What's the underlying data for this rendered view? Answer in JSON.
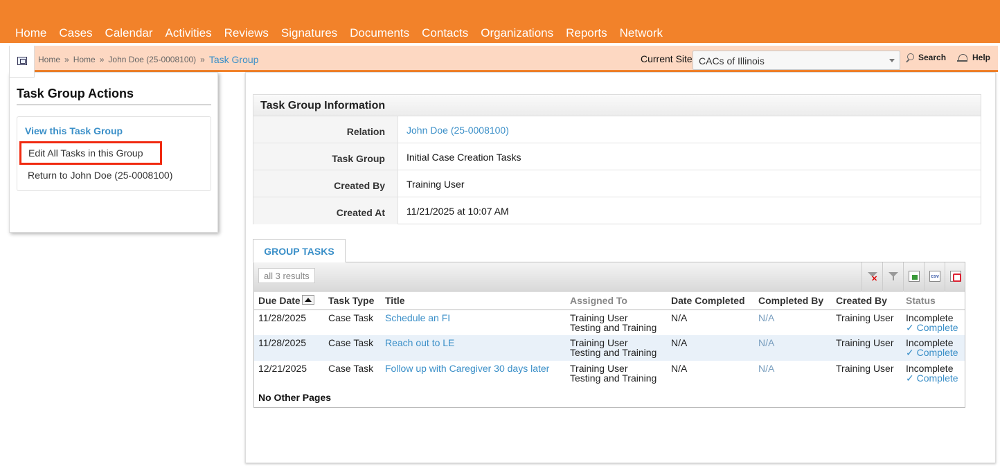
{
  "nav": {
    "items": [
      "Home",
      "Cases",
      "Calendar",
      "Activities",
      "Reviews",
      "Signatures",
      "Documents",
      "Contacts",
      "Organizations",
      "Reports",
      "Network"
    ]
  },
  "breadcrumb": {
    "items": [
      "Home",
      "Home",
      "John Doe (25-0008100)"
    ],
    "separator": "»",
    "current": "Task Group"
  },
  "site": {
    "label": "Current Site",
    "selected": "CACs of Illinois"
  },
  "toolbar": {
    "search_label": "Search",
    "help_label": "Help"
  },
  "sidebar": {
    "title": "Task Group Actions",
    "actions": {
      "view": "View this Task Group",
      "edit": "Edit All Tasks in this Group",
      "return": "Return to John Doe (25-0008100)"
    }
  },
  "info": {
    "title": "Task Group Information",
    "rows": [
      {
        "label": "Relation",
        "value": "John Doe (25-0008100)"
      },
      {
        "label": "Task Group",
        "value": "Initial Case Creation Tasks"
      },
      {
        "label": "Created By",
        "value": "Training User"
      },
      {
        "label": "Created At",
        "value": "11/21/2025 at 10:07 AM"
      }
    ]
  },
  "tab": {
    "label": "GROUP TASKS"
  },
  "grid": {
    "results_label": "all 3 results",
    "columns": [
      "Due Date",
      "Task Type",
      "Title",
      "Assigned To",
      "Date Completed",
      "Completed By",
      "Created By",
      "Status"
    ],
    "rows": [
      {
        "due": "11/28/2025",
        "type": "Case Task",
        "title": "Schedule an FI",
        "assigned1": "Training User",
        "assigned2": "Testing and Training",
        "date_completed": "N/A",
        "completed_by": "N/A",
        "created_by": "Training User",
        "status": "Incomplete",
        "action": "✓ Complete"
      },
      {
        "due": "11/28/2025",
        "type": "Case Task",
        "title": "Reach out to LE",
        "assigned1": "Training User",
        "assigned2": "Testing and Training",
        "date_completed": "N/A",
        "completed_by": "N/A",
        "created_by": "Training User",
        "status": "Incomplete",
        "action": "✓ Complete"
      },
      {
        "due": "12/21/2025",
        "type": "Case Task",
        "title": "Follow up with Caregiver 30 days later",
        "assigned1": "Training User",
        "assigned2": "Testing and Training",
        "date_completed": "N/A",
        "completed_by": "N/A",
        "created_by": "Training User",
        "status": "Incomplete",
        "action": "✓ Complete"
      }
    ],
    "pagination": "No Other Pages",
    "csv_icon_text": "csv"
  },
  "icons": {
    "grid_toolbar": [
      "clear-filter-icon",
      "filter-icon",
      "excel-export-icon",
      "csv-export-icon",
      "pdf-export-icon"
    ],
    "sort": "sort-asc-icon",
    "sidebar_toggle": "sidebar-toggle-icon"
  },
  "colors": {
    "brand": "#f2822a",
    "breadcrumb_bg": "#fdd8c2",
    "link": "#3a8fc8",
    "highlight_border": "#f02a10",
    "alt_row": "#e9f1f9"
  }
}
